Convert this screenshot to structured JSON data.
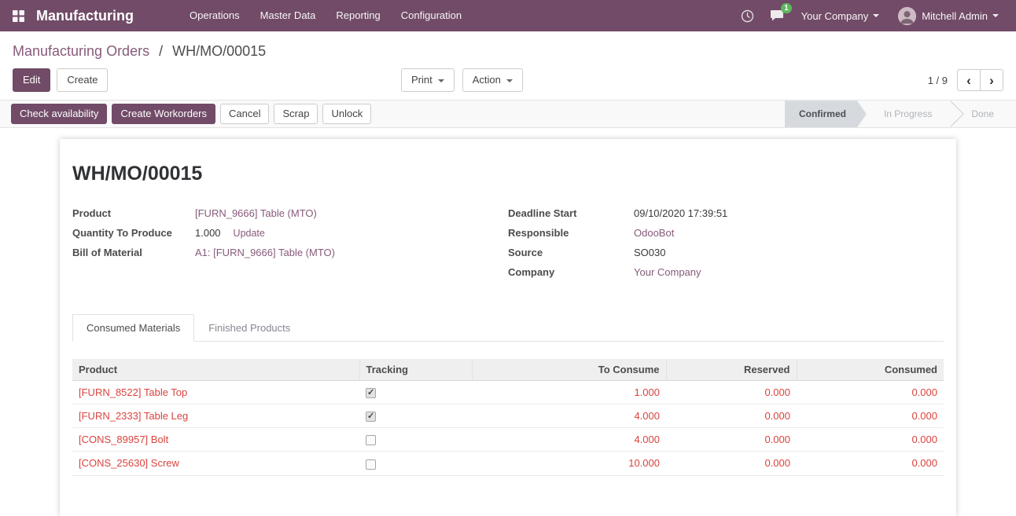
{
  "navbar": {
    "app_name": "Manufacturing",
    "menus": [
      "Operations",
      "Master Data",
      "Reporting",
      "Configuration"
    ],
    "activity_icon": "clock-icon",
    "messages_icon": "chat-bubble-icon",
    "messages_badge": "1",
    "company_menu": "Your Company",
    "user_menu": "Mitchell Admin"
  },
  "breadcrumb": {
    "parent": "Manufacturing Orders",
    "separator": "/",
    "current": "WH/MO/00015"
  },
  "control_panel": {
    "edit_label": "Edit",
    "create_label": "Create",
    "print_label": "Print",
    "action_label": "Action",
    "pager_value": "1 / 9",
    "pager_prev": "‹",
    "pager_next": "›"
  },
  "statusbar": {
    "buttons": [
      {
        "label": "Check availability",
        "style": "primary"
      },
      {
        "label": "Create Workorders",
        "style": "primary"
      },
      {
        "label": "Cancel",
        "style": "default"
      },
      {
        "label": "Scrap",
        "style": "default"
      },
      {
        "label": "Unlock",
        "style": "default"
      }
    ],
    "states": [
      {
        "label": "Confirmed",
        "active": true
      },
      {
        "label": "In Progress",
        "active": false
      },
      {
        "label": "Done",
        "active": false
      }
    ]
  },
  "sheet": {
    "title": "WH/MO/00015",
    "fields_left": [
      {
        "label": "Product",
        "value": "[FURN_9666] Table (MTO)",
        "type": "link"
      },
      {
        "label": "Quantity To Produce",
        "value": "1.000",
        "action": "Update"
      },
      {
        "label": "Bill of Material",
        "value": "A1: [FURN_9666] Table (MTO)",
        "type": "link"
      }
    ],
    "fields_right": [
      {
        "label": "Deadline Start",
        "value": "09/10/2020 17:39:51"
      },
      {
        "label": "Responsible",
        "value": "OdooBot",
        "type": "link"
      },
      {
        "label": "Source",
        "value": "SO030"
      },
      {
        "label": "Company",
        "value": "Your Company",
        "type": "link"
      }
    ],
    "tabs": [
      {
        "label": "Consumed Materials",
        "active": true
      },
      {
        "label": "Finished Products",
        "active": false
      }
    ],
    "table": {
      "columns": [
        "Product",
        "Tracking",
        "To Consume",
        "Reserved",
        "Consumed"
      ],
      "rows": [
        {
          "product": "[FURN_8522] Table Top",
          "tracking": true,
          "to_consume": "1.000",
          "reserved": "0.000",
          "consumed": "0.000"
        },
        {
          "product": "[FURN_2333] Table Leg",
          "tracking": true,
          "to_consume": "4.000",
          "reserved": "0.000",
          "consumed": "0.000"
        },
        {
          "product": "[CONS_89957] Bolt",
          "tracking": false,
          "to_consume": "4.000",
          "reserved": "0.000",
          "consumed": "0.000"
        },
        {
          "product": "[CONS_25630] Screw",
          "tracking": false,
          "to_consume": "10.000",
          "reserved": "0.000",
          "consumed": "0.000"
        }
      ]
    }
  },
  "colors": {
    "navbar_bg": "#714B67",
    "primary_button": "#714B67",
    "link": "#875A7B",
    "danger_text": "#d9433e",
    "badge_green": "#5cb85c",
    "state_active_bg": "#d6dade"
  }
}
